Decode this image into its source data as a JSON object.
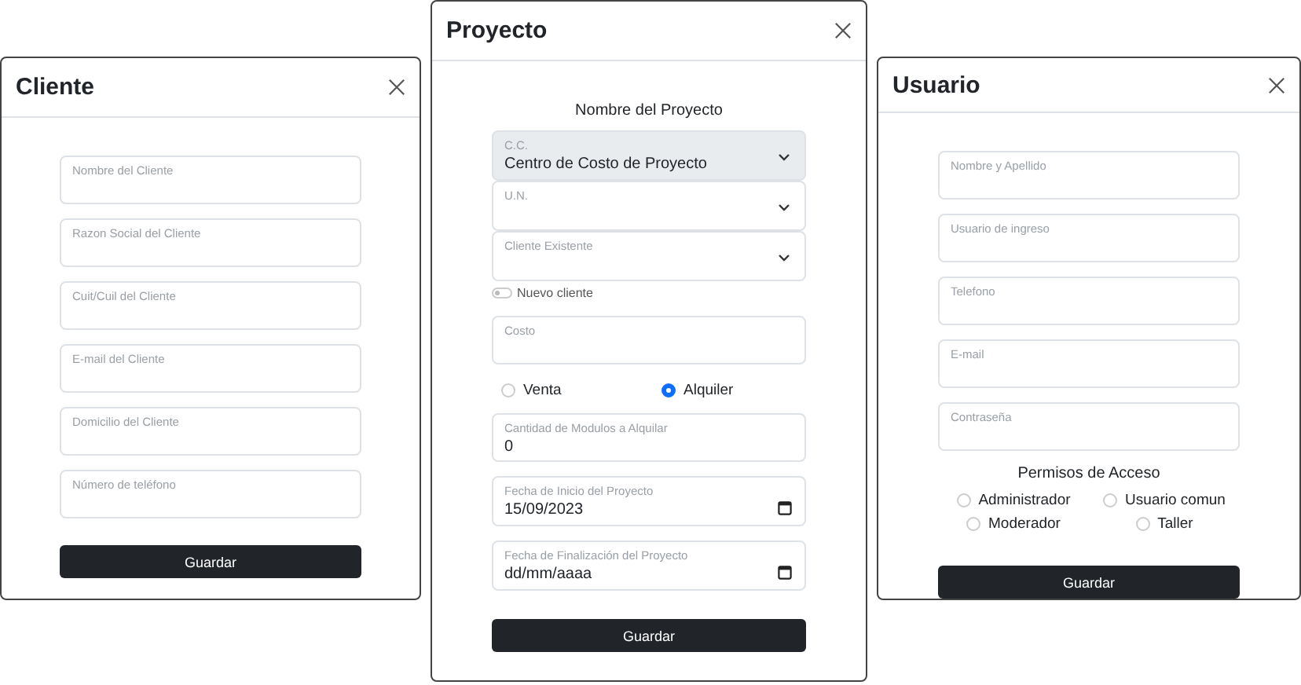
{
  "modals": [
    {
      "title": "Cliente",
      "items": [
        {
          "kind": "field",
          "label": "Nombre del Cliente"
        },
        {
          "kind": "field",
          "label": "Razon Social del Cliente"
        },
        {
          "kind": "field",
          "label": "Cuit/Cuil del Cliente"
        },
        {
          "kind": "field",
          "label": "E-mail del Cliente"
        },
        {
          "kind": "field",
          "label": "Domicilio del Cliente"
        },
        {
          "kind": "field",
          "label": "Número de teléfono"
        },
        {
          "kind": "button",
          "label": "Guardar"
        }
      ]
    },
    {
      "title": "Proyecto",
      "items": [
        {
          "kind": "heading",
          "label": "Nombre del Proyecto"
        },
        {
          "kind": "select",
          "label": "C.C.",
          "value": "Centro de Costo de Proyecto",
          "disabled": true
        },
        {
          "kind": "select",
          "label": "U.N.",
          "disabled": false
        },
        {
          "kind": "select",
          "label": "Cliente Existente",
          "disabled": false
        },
        {
          "kind": "switch",
          "label": "Nuevo cliente",
          "on": false
        },
        {
          "kind": "field",
          "label": "Costo"
        },
        {
          "kind": "radios",
          "options": [
            {
              "label": "Venta",
              "selected": false
            },
            {
              "label": "Alquiler",
              "selected": true
            }
          ]
        },
        {
          "kind": "field",
          "label": "Cantidad de Modulos a Alquilar",
          "value": "0"
        },
        {
          "kind": "date",
          "label": "Fecha de Inicio del Proyecto",
          "value": "15/09/2023"
        },
        {
          "kind": "date",
          "label": "Fecha de Finalización del Proyecto",
          "value": "dd/mm/aaaa"
        },
        {
          "kind": "button",
          "label": "Guardar"
        }
      ]
    },
    {
      "title": "Usuario",
      "items": [
        {
          "kind": "field",
          "label": "Nombre y Apellido"
        },
        {
          "kind": "field",
          "label": "Usuario de ingreso"
        },
        {
          "kind": "field",
          "label": "Telefono"
        },
        {
          "kind": "field",
          "label": "E-mail"
        },
        {
          "kind": "field",
          "label": "Contraseña"
        },
        {
          "kind": "heading",
          "label": "Permisos de Acceso"
        },
        {
          "kind": "radios",
          "options": [
            {
              "label": "Administrador",
              "selected": false
            },
            {
              "label": "Usuario comun",
              "selected": false
            },
            {
              "label": "Moderador",
              "selected": false
            },
            {
              "label": "Taller",
              "selected": false
            }
          ]
        },
        {
          "kind": "button",
          "label": "Guardar"
        }
      ]
    }
  ]
}
